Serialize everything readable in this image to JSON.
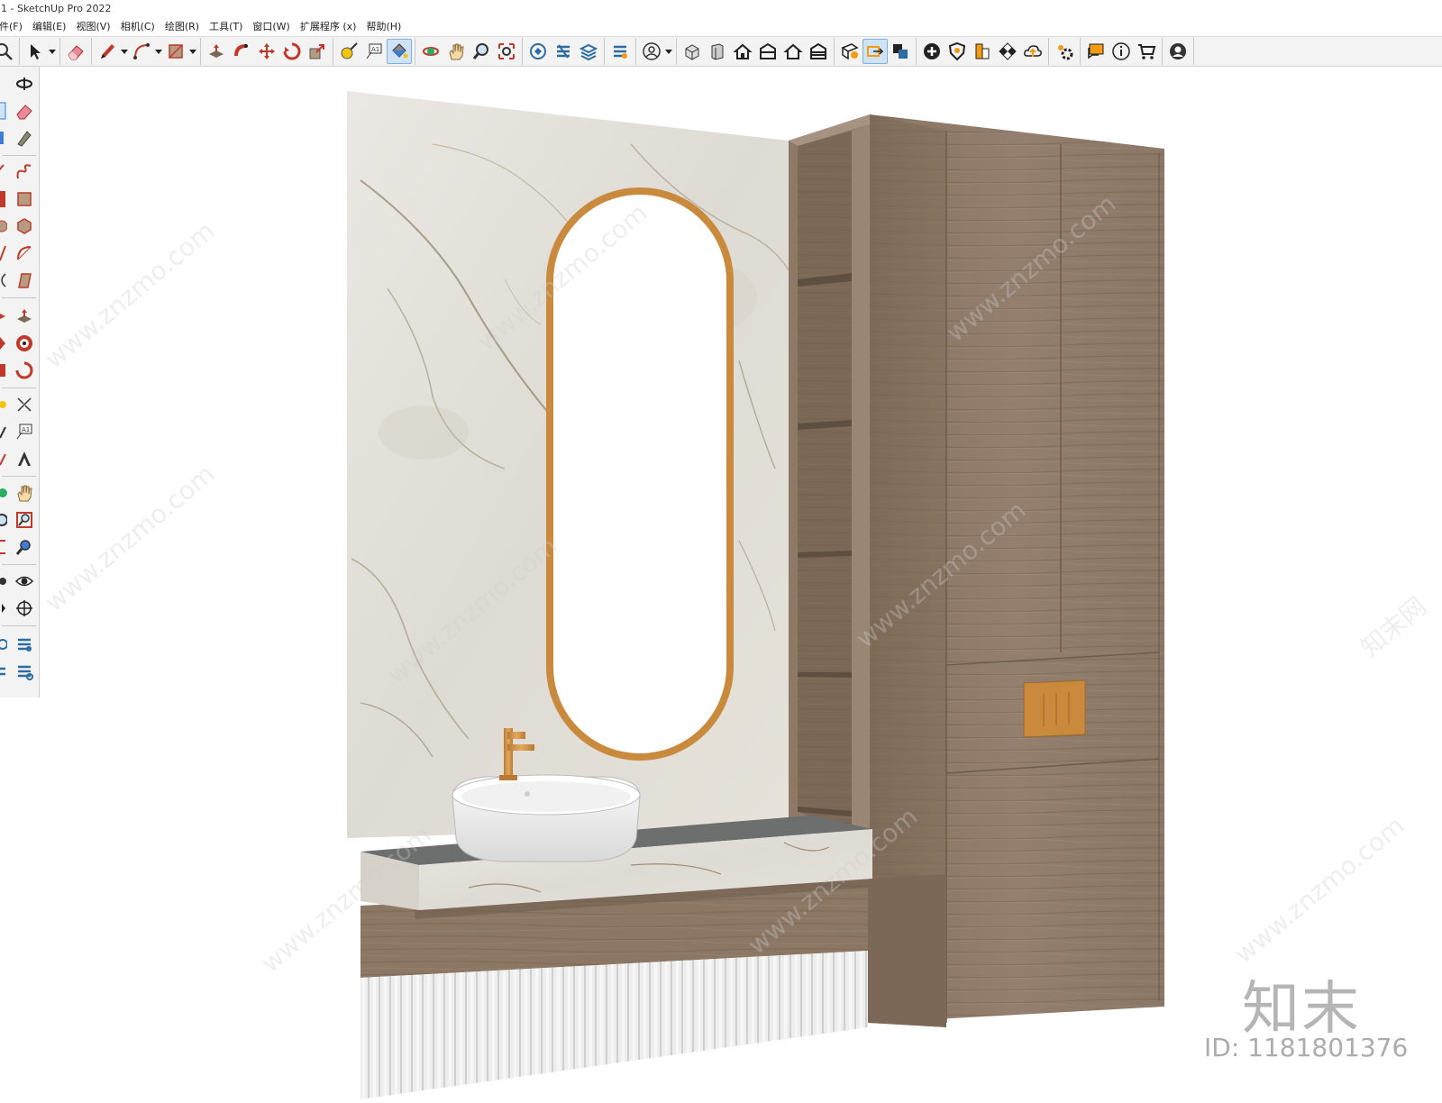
{
  "window": {
    "title": "1 - SketchUp Pro 2022"
  },
  "menu": [
    {
      "label": "件(F)"
    },
    {
      "label": "编辑(E)"
    },
    {
      "label": "视图(V)"
    },
    {
      "label": "相机(C)"
    },
    {
      "label": "绘图(R)"
    },
    {
      "label": "工具(T)"
    },
    {
      "label": "窗口(W)"
    },
    {
      "label": "扩展程序 (x)"
    },
    {
      "label": "帮助(H)"
    }
  ],
  "toolbar": {
    "tools": [
      "search-icon",
      "select-arrow-icon",
      "eraser-icon",
      "pencil-line-icon",
      "arc-icon",
      "rectangle-icon",
      "push-pull-icon",
      "follow-me-icon",
      "move-icon",
      "rotate-icon",
      "scale-icon",
      "tape-measure-icon",
      "text-icon",
      "paint-bucket-icon",
      "orbit-icon",
      "pan-icon",
      "zoom-icon",
      "zoom-extents-icon",
      "warehouse-icon",
      "extension-warehouse-icon",
      "layout-icon",
      "sandbox-icon",
      "account-icon",
      "iso-view-icon",
      "top-view-icon",
      "front-view-icon",
      "right-view-icon",
      "back-view-icon",
      "left-view-icon",
      "section-plane-icon",
      "section-display-icon",
      "section-cut-icon",
      "add-icon",
      "shield-icon",
      "material-icon",
      "checker-icon",
      "cloud-icon",
      "settings-icon",
      "message-icon",
      "info-icon",
      "cart-icon",
      "user-icon"
    ],
    "active_tool": "paint-bucket-icon"
  },
  "left_toolbar": {
    "tools": [
      "orbit-icon",
      "eraser-icon",
      "paint-bucket-icon",
      "freehand-icon",
      "rectangle-icon",
      "polygon-icon",
      "pie-icon",
      "rotated-rectangle-icon",
      "push-pull-icon",
      "follow-me-icon",
      "scale-icon",
      "dimension-icon",
      "text-icon",
      "3d-text-icon",
      "pan-icon",
      "zoom-window-icon",
      "zoom-previous-icon",
      "eye-icon",
      "walk-icon",
      "warehouse-icon",
      "extension-icon"
    ]
  },
  "scene": {
    "description_colors": {
      "marble": "#e9e6e1",
      "wood": "#8d7a69",
      "brass": "#c98a3e",
      "countertop": "#6e6f6f"
    }
  },
  "watermark": {
    "site": "www.znzmo.com",
    "brand": "知末网",
    "logo": "知末",
    "id": "ID: 1181801376"
  }
}
